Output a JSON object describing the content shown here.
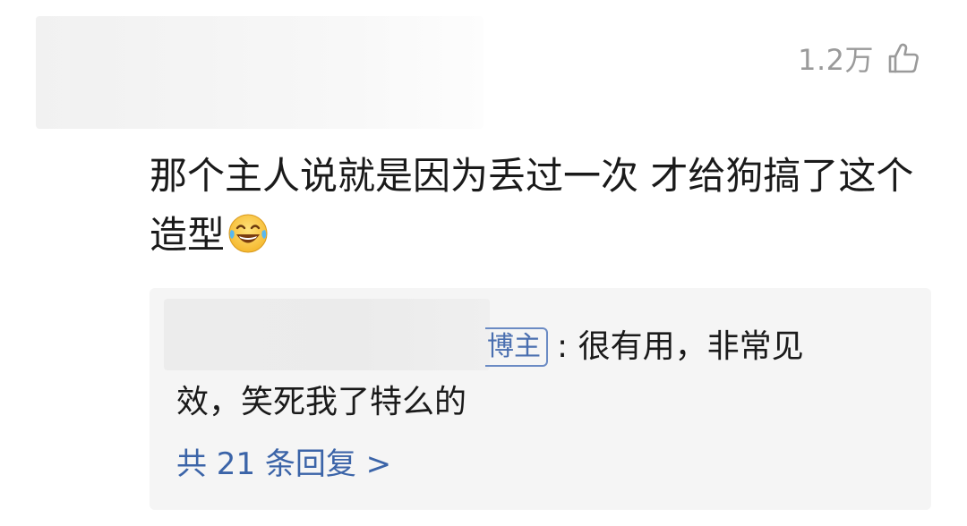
{
  "comment": {
    "like_count": "1.2万",
    "text": "那个主人说就是因为丢过一次 才给狗搞了这个造型"
  },
  "reply": {
    "author_badge": "博主",
    "text_line1": ": 很有用，非常见",
    "text_line2": "效，笑死我了特么的",
    "view_all_label": "共 21 条回复 >"
  },
  "icons": {
    "like": "thumbs-up-icon",
    "emoji": "tears-of-joy-emoji"
  },
  "colors": {
    "link": "#3b64a8",
    "muted": "#9a9a9a",
    "reply_bg": "#f5f5f5"
  }
}
